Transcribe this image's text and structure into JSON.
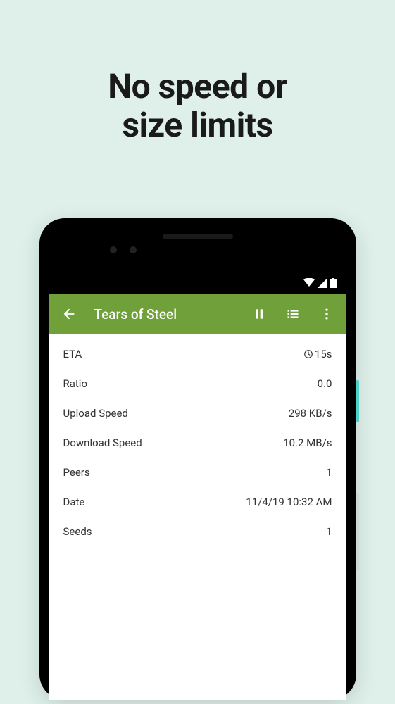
{
  "headline_line1": "No speed or",
  "headline_line2": "size limits",
  "app": {
    "title": "Tears of Steel",
    "colors": {
      "appbar": "#6fa03a"
    },
    "rows": [
      {
        "label": "ETA",
        "value": "15s",
        "has_clock": true
      },
      {
        "label": "Ratio",
        "value": "0.0"
      },
      {
        "label": "Upload Speed",
        "value": "298 KB/s"
      },
      {
        "label": "Download Speed",
        "value": "10.2 MB/s"
      },
      {
        "label": "Peers",
        "value": "1"
      },
      {
        "label": "Date",
        "value": "11/4/19 10:32 AM"
      },
      {
        "label": "Seeds",
        "value": "1"
      }
    ]
  }
}
